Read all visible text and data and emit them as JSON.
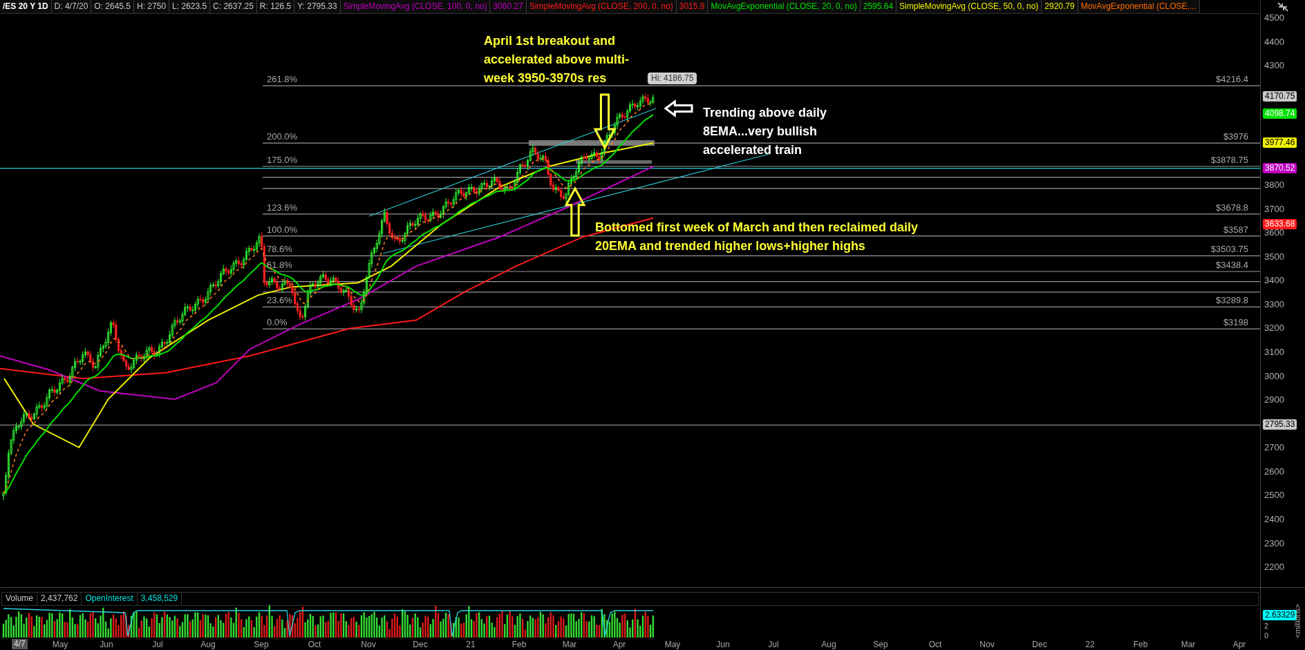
{
  "header": {
    "symbol": "/ES 20 Y 1D",
    "fields": [
      "D: 4/7/20",
      "O: 2645.5",
      "H: 2750",
      "L: 2623.5",
      "C: 2637.25",
      "R: 126.5",
      "Y: 2795.33"
    ],
    "studies": [
      {
        "name": "SimpleMovingAvg (CLOSE, 100, 0, no)",
        "value": "3060.27",
        "color": "#c000c0"
      },
      {
        "name": "SimpleMovingAvg (CLOSE, 200, 0, no)",
        "value": "3015.9",
        "color": "#ff1a1a"
      },
      {
        "name": "MovAvgExponential (CLOSE, 20, 0, no)",
        "value": "2595.64",
        "color": "#00e000"
      },
      {
        "name": "SimpleMovingAvg (CLOSE, 50, 0, no)",
        "value": "2920.79",
        "color": "#f0f000"
      },
      {
        "name": "MovAvgExponential (CLOSE,...",
        "color": "#ff6a00"
      }
    ]
  },
  "price_pane": {
    "fib_levels": [
      {
        "percent": "261.8%",
        "price": "$4216.4"
      },
      {
        "percent": "200.0%",
        "price": "$3976"
      },
      {
        "percent": "175.0%",
        "price": "$3878.75"
      },
      {
        "percent": "123.6%",
        "price": "$3678.8"
      },
      {
        "percent": "100.0%",
        "price": "$3587"
      },
      {
        "percent": "78.6%",
        "price": "$3503.75"
      },
      {
        "percent": "61.8%",
        "price": "$3438.4"
      },
      {
        "percent": "23.6%",
        "price": "$3289.8"
      },
      {
        "percent": "0.0%",
        "price": "$3198"
      }
    ],
    "annotations": [
      {
        "color": "#ffff33",
        "lines": [
          "April 1st breakout and",
          "accelerated above multi-",
          "week 3950-3970s res"
        ]
      },
      {
        "color": "#ffffff",
        "lines": [
          "Trending above daily",
          "8EMA...very bullish",
          "accelerated train"
        ]
      },
      {
        "color": "#ffff33",
        "lines": [
          "Bottomed first week of March and then reclaimed daily",
          "20EMA and trended higher lows+higher highs"
        ]
      }
    ],
    "high_marker": "Hi: 4186.75",
    "axis_ticks": [
      "4500",
      "4400",
      "4300",
      "3800",
      "3700",
      "3600",
      "3500",
      "3400",
      "3300",
      "3200",
      "3100",
      "3000",
      "2900",
      "2700",
      "2600",
      "2500",
      "2400",
      "2300",
      "2200"
    ],
    "price_tags": [
      {
        "value": "4170.75",
        "color": "#c8c8c8"
      },
      {
        "value": "4098.74",
        "color": "#00e000"
      },
      {
        "value": "3977.46",
        "color": "#f0f000"
      },
      {
        "value": "3870.52",
        "color": "#c000c0"
      },
      {
        "value": "3633.68",
        "color": "#ff1a1a"
      },
      {
        "value": "2795.33",
        "color": "#c8c8c8"
      }
    ]
  },
  "volume_pane": {
    "fields": [
      {
        "label": "Volume",
        "value": "2,437,762",
        "color": "#cccccc"
      },
      {
        "label": "OpenInterest",
        "value": "3,458,529",
        "color": "#00e5e5"
      }
    ],
    "price_tag": {
      "value": "2.63329",
      "color": "#00ffff"
    },
    "axis_ticks": [
      "2",
      "0"
    ],
    "unit": "<millions>"
  },
  "time_axis": {
    "current": "4/7",
    "labels": [
      "May",
      "Jun",
      "Jul",
      "Aug",
      "Sep",
      "Oct",
      "Nov",
      "Dec",
      "21",
      "Feb",
      "Mar",
      "Apr",
      "May",
      "Jun",
      "Jul",
      "Aug",
      "Sep",
      "Oct",
      "Nov",
      "Dec",
      "22",
      "Feb",
      "Mar",
      "Apr"
    ]
  }
}
